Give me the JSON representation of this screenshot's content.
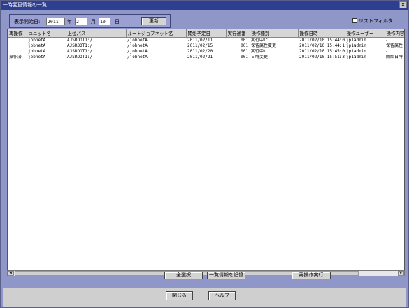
{
  "window": {
    "title": "一時変更情報の一覧",
    "close_glyph": "×"
  },
  "filter": {
    "start_label": "表示開始日:",
    "year_value": "2011",
    "year_unit": "年",
    "month_value": "2",
    "month_unit": "月",
    "day_value": "10",
    "day_unit": "日",
    "update_button": "更新"
  },
  "list_filter": {
    "label": "リストフィルタ",
    "checked": false
  },
  "table": {
    "columns": [
      "再操作",
      "ユニット名",
      "上位パス",
      "ルートジョブネット名",
      "開始予定日",
      "実行通番",
      "操作種別",
      "操作日時",
      "操作ユーザー",
      "操作内容"
    ],
    "rows": [
      [
        "",
        "jobnetA",
        "AJSROOT1:/",
        "/jobnetA",
        "2011/02/11",
        "001",
        "実行中止",
        "2011/02/10 15:44:02",
        "jp1admin",
        "-"
      ],
      [
        "",
        "jobnetA",
        "AJSROOT1:/",
        "/jobnetA",
        "2011/02/15",
        "001",
        "保留属性変更",
        "2011/02/10 15:44:15",
        "jp1admin",
        "保留属性"
      ],
      [
        "",
        "jobnetA",
        "AJSROOT1:/",
        "/jobnetA",
        "2011/02/20",
        "001",
        "実行中止",
        "2011/02/10 15:45:02",
        "jp1admin",
        "-"
      ],
      [
        "操作済",
        "jobnetA",
        "AJSROOT1:/",
        "/jobnetA",
        "2011/02/21",
        "001",
        "日時変更",
        "2011/02/10 15:51:38",
        "jp1admin",
        "開始日時"
      ]
    ]
  },
  "scrollbar": {
    "left_arrow": "◂",
    "right_arrow": "▸"
  },
  "actions": {
    "select_all": "全選択",
    "save_list": "一覧情報を記憶",
    "reexecute": "再操作実行"
  },
  "footer": {
    "close": "閉じる",
    "help": "ヘルプ"
  }
}
